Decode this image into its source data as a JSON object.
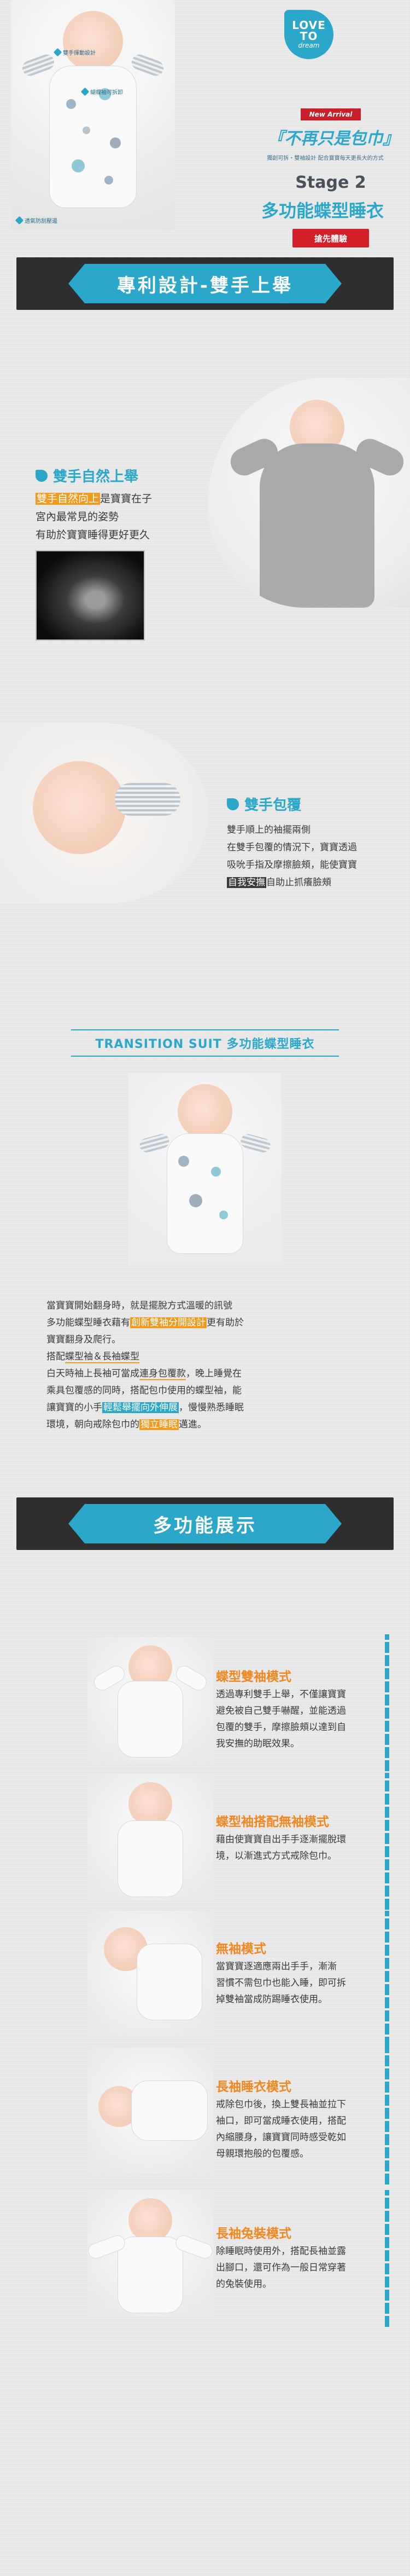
{
  "hero": {
    "callouts": [
      "雙手揮動設計",
      "蝴蝶袖可拆卸",
      "透氣防刮壓邊"
    ],
    "logo_line1": "LOVE",
    "logo_line2": "TO",
    "logo_line3": "dream",
    "new_arrival": "New Arrival",
    "slogan": "『不再只是包巾』",
    "slogan_sub": "獨創可拆・雙袖設計 配合寶寶每天更長大的方式",
    "stage": "Stage 2",
    "title": "多功能蝶型睡衣",
    "preorder_button": "搶先體驗"
  },
  "section1": {
    "title": "專利設計-雙手上舉"
  },
  "feature1": {
    "heading": "雙手自然上舉",
    "line1_hl": "雙手自然向上",
    "line1_rest": "是寶寶在子",
    "line2": "宮內最常見的姿勢",
    "line3": "有助於寶寶睡得更好更久"
  },
  "feature2": {
    "heading": "雙手包覆",
    "line1": "雙手順上的袖擺兩側",
    "line2": "在雙手包覆的情況下，寶寶透過",
    "line3": "吸吮手指及摩擦臉頰，能使寶寶",
    "line4_hl": "自我安撫",
    "line4_rest": "自助止抓癢臉頰"
  },
  "transition": {
    "title": "TRANSITION SUIT 多功能蝶型睡衣",
    "p1_a": "當寶寶開始翻身時，就是擺脫方式溫暖的訊號",
    "p1_b": "多功能蝶型睡衣藉有",
    "p1_b_hl": "創新雙袖分開設計",
    "p1_b_rest": "更有助於",
    "p1_c": "寶寶翻身及爬行。",
    "p2_a": "搭配",
    "p2_a_u": "蝶型袖＆長袖蝶型",
    "p2_b": "白天時袖上長袖可當成",
    "p2_b_u": "連身包覆款",
    "p2_b_rest": "，晚上睡覺在",
    "p2_c": "乘具包覆感的同時，搭配包巾使用的蝶型袖，能",
    "p2_d": "讓寶寶的小手",
    "p2_d_hl": "輕鬆舉擺向外伸展",
    "p2_d_rest": "，慢慢熟悉睡眠",
    "p2_e": "環境，朝向戒除包巾的",
    "p2_e_hl": "獨立睡眠",
    "p2_e_rest": "邁進。"
  },
  "section2": {
    "title": "多功能展示"
  },
  "modes": [
    {
      "title": "蝶型雙袖模式",
      "lines": [
        "透過專利雙手上舉，不僅讓寶寶",
        "避免被自己雙手嚇醒，並能透過",
        "包覆的雙手，摩擦臉頰以達到自",
        "我安撫的助眠效果。"
      ]
    },
    {
      "title": "蝶型袖搭配無袖模式",
      "lines": [
        "藉由使寶寶自出手手逐漸擺脫環",
        "境，以漸進式方式戒除包巾。"
      ]
    },
    {
      "title": "無袖模式",
      "lines": [
        "當寶寶逐適應兩出手手，漸漸",
        "習慣不需包巾也能入睡，即可拆",
        "掉雙袖當成防踢睡衣使用。"
      ]
    },
    {
      "title": "長袖睡衣模式",
      "lines": [
        "戒除包巾後，換上雙長袖並拉下",
        "袖口，即可當成睡衣使用，搭配",
        "內縮腰身，讓寶寶同時感受乾如",
        "母親環抱般的包覆感。"
      ]
    },
    {
      "title": "長袖兔裝模式",
      "lines": [
        "除睡眠時使用外，搭配長袖並露",
        "出腳口，還可作為一般日常穿著",
        "的兔裝使用。"
      ]
    }
  ],
  "colors": {
    "accent_blue": "#2aa7c9",
    "accent_orange": "#f0871f",
    "accent_red": "#d21f2a",
    "dark": "#2e2e2e"
  }
}
